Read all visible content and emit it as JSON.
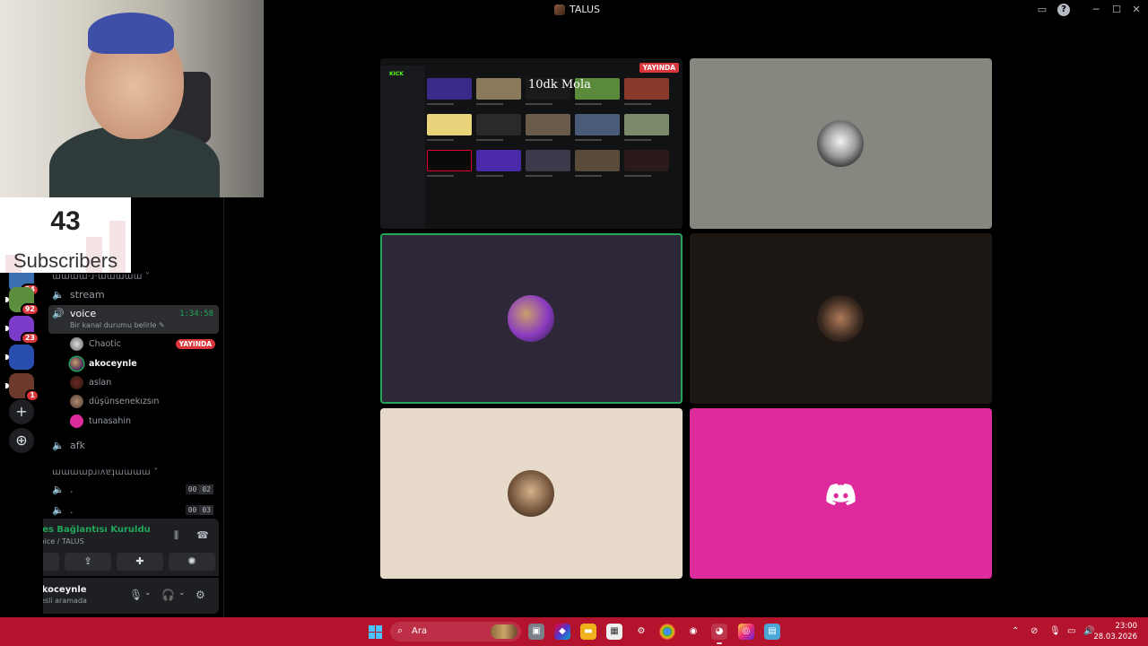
{
  "window": {
    "title": "TALUS"
  },
  "overlay": {
    "subscribers_count": "43",
    "subscribers_label": "Subscribers"
  },
  "guilds": [
    {
      "badge": "24",
      "color": "#3a6fb0"
    },
    {
      "badge": "92",
      "color": "#5b8f3e"
    },
    {
      "badge": "23",
      "color": "#7a3cc9"
    },
    {
      "badge": "",
      "color": "#2a4db0"
    },
    {
      "badge": "1",
      "color": "#6b3a2a"
    }
  ],
  "sidebar": {
    "category_top": "ɯɯɯɯ·ɹ·ɯɯɯɯɯ ˅",
    "channels": {
      "stream": "stream",
      "voice": "voice",
      "voice_timer": "1:34:58",
      "voice_status": "Bir kanal durumu belirle ✎",
      "afk": "afk"
    },
    "members": [
      {
        "name": "Chaotic",
        "live": "YAYINDA"
      },
      {
        "name": "akoceynle"
      },
      {
        "name": "aslan"
      },
      {
        "name": "düşünsenekızsın"
      },
      {
        "name": "tunasahin"
      }
    ],
    "category_private": "ɯɯɯɯpɹıʌɐʇɯɯɯɯ ˅",
    "private_channels": [
      {
        "name": ".",
        "count_a": "00",
        "count_b": "02"
      },
      {
        "name": ".",
        "count_a": "00",
        "count_b": "03"
      }
    ]
  },
  "voice_panel": {
    "title": "Ses Bağlantısı Kuruldu",
    "subtitle": "voice / TALUS"
  },
  "user_panel": {
    "name": "akoceynle",
    "status": "Sesli aramada"
  },
  "stream": {
    "live_badge": "YAYINDA",
    "platform": "KICK",
    "thumb_text": "10dk Mola"
  },
  "colors": {
    "green": "#23a55a",
    "live_red": "#da373c",
    "tile_grey": "#86887f",
    "tile_purple": "#2e2737",
    "tile_brown": "#1d1714",
    "tile_beige": "#e7dacb",
    "tile_pink": "#de2b9c",
    "taskbar": "#b3132d"
  },
  "taskbar": {
    "search_placeholder": "Ara",
    "time": "23:00",
    "date": "28.03.2026"
  }
}
